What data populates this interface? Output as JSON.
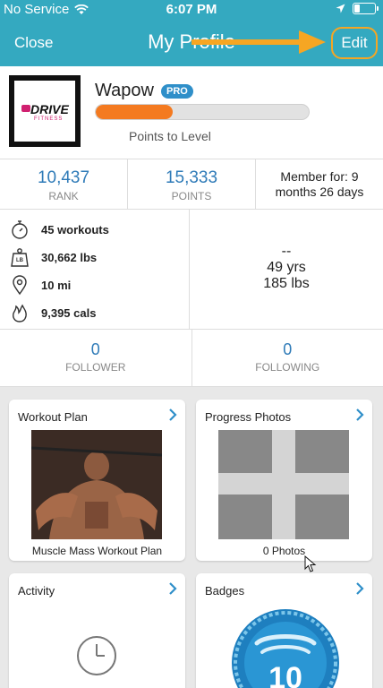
{
  "status_bar": {
    "carrier": "No Service",
    "time": "6:07 PM"
  },
  "nav": {
    "close_label": "Close",
    "title": "My Profile",
    "edit_label": "Edit"
  },
  "profile": {
    "logo_text": "DRIVE",
    "logo_subtext": "FITNESS",
    "username": "Wapow",
    "badge": "PRO",
    "progress": 0.36,
    "progress_label": "Points to Level"
  },
  "stats": {
    "rank_value": "10,437",
    "rank_label": "RANK",
    "points_value": "15,333",
    "points_label": "POINTS",
    "member_line1": "Member for: 9",
    "member_line2": "months 26 days"
  },
  "details": {
    "workouts": "45 workouts",
    "weight": "30,662 lbs",
    "distance": "10 mi",
    "calories": "9,395 cals",
    "dash": "--",
    "age": "49 yrs",
    "body_weight": "185 lbs"
  },
  "follow": {
    "follower_count": "0",
    "follower_label": "FOLLOWER",
    "following_count": "0",
    "following_label": "FOLLOWING"
  },
  "cards": {
    "workout_plan_title": "Workout Plan",
    "workout_plan_caption": "Muscle Mass Workout Plan",
    "progress_photos_title": "Progress Photos",
    "progress_photos_caption": "0 Photos",
    "activity_title": "Activity",
    "badges_title": "Badges",
    "badge_number": "10"
  },
  "colors": {
    "header": "#34a9c0",
    "accent_blue": "#2f7bb8",
    "progress_orange": "#f47a20",
    "highlight": "#f6a623"
  }
}
